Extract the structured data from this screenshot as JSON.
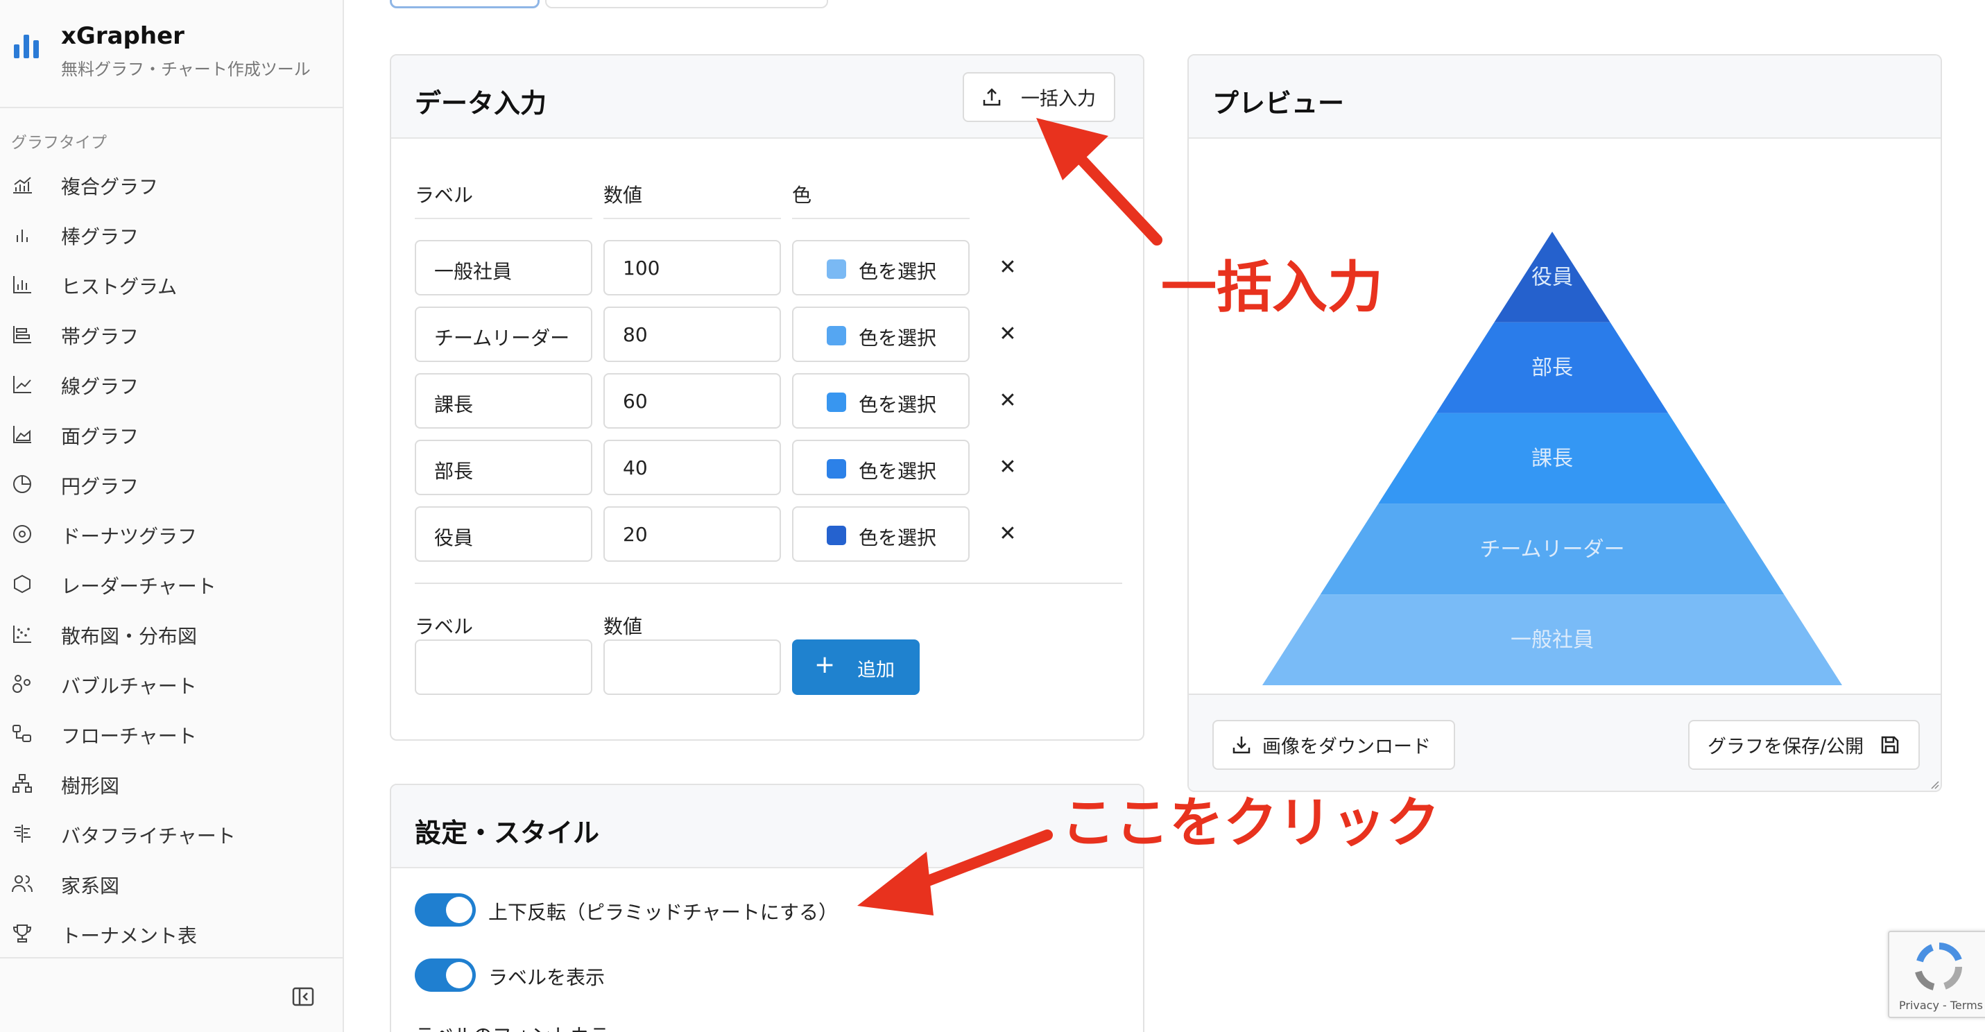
{
  "app": {
    "title": "xGrapher",
    "subtitle": "無料グラフ・チャート作成ツール"
  },
  "sidebar": {
    "section_label": "グラフタイプ",
    "items": [
      {
        "label": "複合グラフ",
        "icon": "combo-chart-icon"
      },
      {
        "label": "棒グラフ",
        "icon": "bar-chart-icon"
      },
      {
        "label": "ヒストグラム",
        "icon": "histogram-icon"
      },
      {
        "label": "帯グラフ",
        "icon": "stacked-bar-icon"
      },
      {
        "label": "線グラフ",
        "icon": "line-chart-icon"
      },
      {
        "label": "面グラフ",
        "icon": "area-chart-icon"
      },
      {
        "label": "円グラフ",
        "icon": "pie-chart-icon"
      },
      {
        "label": "ドーナツグラフ",
        "icon": "donut-chart-icon"
      },
      {
        "label": "レーダーチャート",
        "icon": "hexagon-icon"
      },
      {
        "label": "散布図・分布図",
        "icon": "scatter-icon"
      },
      {
        "label": "バブルチャート",
        "icon": "bubble-icon"
      },
      {
        "label": "フローチャート",
        "icon": "flowchart-icon"
      },
      {
        "label": "樹形図",
        "icon": "tree-icon"
      },
      {
        "label": "バタフライチャート",
        "icon": "butterfly-icon"
      },
      {
        "label": "家系図",
        "icon": "family-icon"
      },
      {
        "label": "トーナメント表",
        "icon": "trophy-icon"
      }
    ]
  },
  "data_input": {
    "title": "データ入力",
    "bulk_button": "一括入力",
    "col_label": "ラベル",
    "col_value": "数値",
    "col_color": "色",
    "color_button": "色を選択",
    "rows": [
      {
        "label": "一般社員",
        "value": "100",
        "color": "#7ab9f4"
      },
      {
        "label": "チームリーダー",
        "value": "80",
        "color": "#55a6f2"
      },
      {
        "label": "課長",
        "value": "60",
        "color": "#3896f0"
      },
      {
        "label": "部長",
        "value": "40",
        "color": "#2c81e8"
      },
      {
        "label": "役員",
        "value": "20",
        "color": "#2562cf"
      }
    ],
    "new_label_head": "ラベル",
    "new_value_head": "数値",
    "add_button": "追加"
  },
  "preview": {
    "title": "プレビュー",
    "download_button": "画像をダウンロード",
    "save_button": "グラフを保存/公開"
  },
  "chart_data": {
    "type": "pyramid",
    "categories": [
      "役員",
      "部長",
      "課長",
      "チームリーダー",
      "一般社員"
    ],
    "values": [
      20,
      40,
      60,
      80,
      100
    ],
    "colors": [
      "#2561cd",
      "#2a7cea",
      "#3497f4",
      "#55a9f3",
      "#79bbf7"
    ],
    "label_color": "#dcebfb"
  },
  "settings": {
    "title": "設定・スタイル",
    "toggle_flip": "上下反転（ピラミッドチャートにする）",
    "toggle_labels": "ラベルを表示",
    "partial_label": "ラベルのフォントカラ"
  },
  "annotations": {
    "bulk": "一括入力",
    "click_here": "ここをクリック",
    "color": "#e8321e"
  },
  "recaptcha": {
    "text": "Privacy - Terms"
  }
}
